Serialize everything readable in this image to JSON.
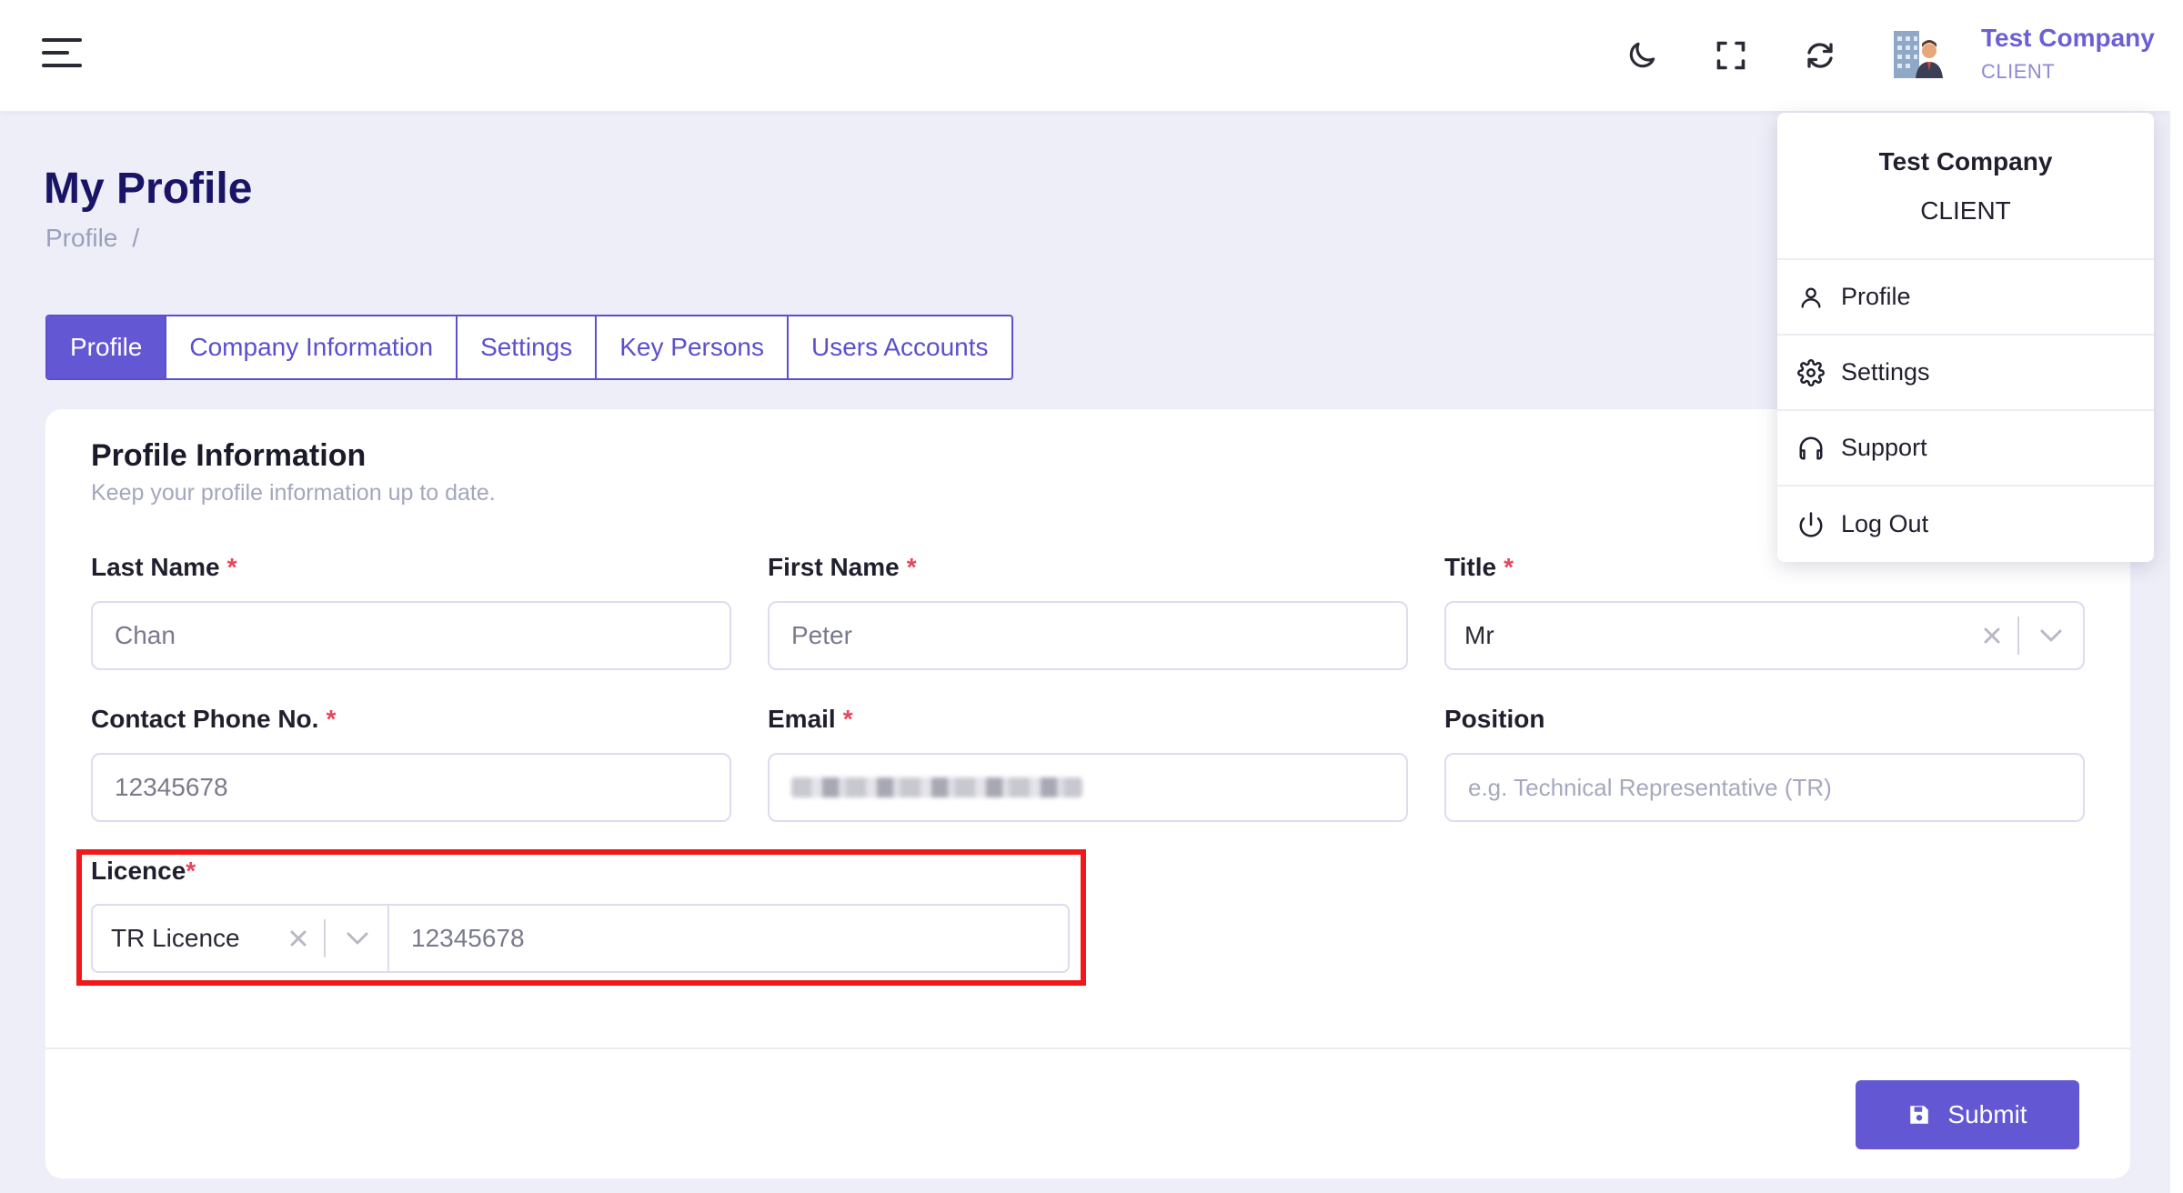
{
  "header": {
    "user_name": "Test Company",
    "user_role": "CLIENT"
  },
  "page": {
    "title": "My Profile",
    "breadcrumb": [
      "Profile",
      "/"
    ]
  },
  "tabs": [
    {
      "label": "Profile",
      "active": true
    },
    {
      "label": "Company Information",
      "active": false
    },
    {
      "label": "Settings",
      "active": false
    },
    {
      "label": "Key Persons",
      "active": false
    },
    {
      "label": "Users Accounts",
      "active": false
    }
  ],
  "card": {
    "title": "Profile Information",
    "subtitle": "Keep your profile information up to date."
  },
  "fields": {
    "last_name": {
      "label": "Last Name",
      "required": "*",
      "value": "Chan"
    },
    "first_name": {
      "label": "First Name",
      "required": "*",
      "value": "Peter"
    },
    "title": {
      "label": "Title",
      "required": "*",
      "value": "Mr"
    },
    "phone": {
      "label": "Contact Phone No.",
      "required": "*",
      "value": "12345678"
    },
    "email": {
      "label": "Email",
      "required": "*"
    },
    "position": {
      "label": "Position",
      "placeholder": "e.g. Technical Representative (TR)"
    },
    "licence": {
      "label": "Licence",
      "required": "*",
      "type_value": "TR Licence",
      "number_value": "12345678"
    }
  },
  "actions": {
    "submit_label": "Submit"
  },
  "dropdown": {
    "name": "Test Company",
    "role": "CLIENT",
    "items": [
      {
        "label": "Profile",
        "icon": "user-icon"
      },
      {
        "label": "Settings",
        "icon": "gear-icon"
      },
      {
        "label": "Support",
        "icon": "headphones-icon"
      },
      {
        "label": "Log Out",
        "icon": "power-icon"
      }
    ]
  },
  "colors": {
    "accent": "#6457d4",
    "title": "#1a1466",
    "required": "#e8455b",
    "highlight": "#f01818",
    "background": "#eeeef8"
  }
}
